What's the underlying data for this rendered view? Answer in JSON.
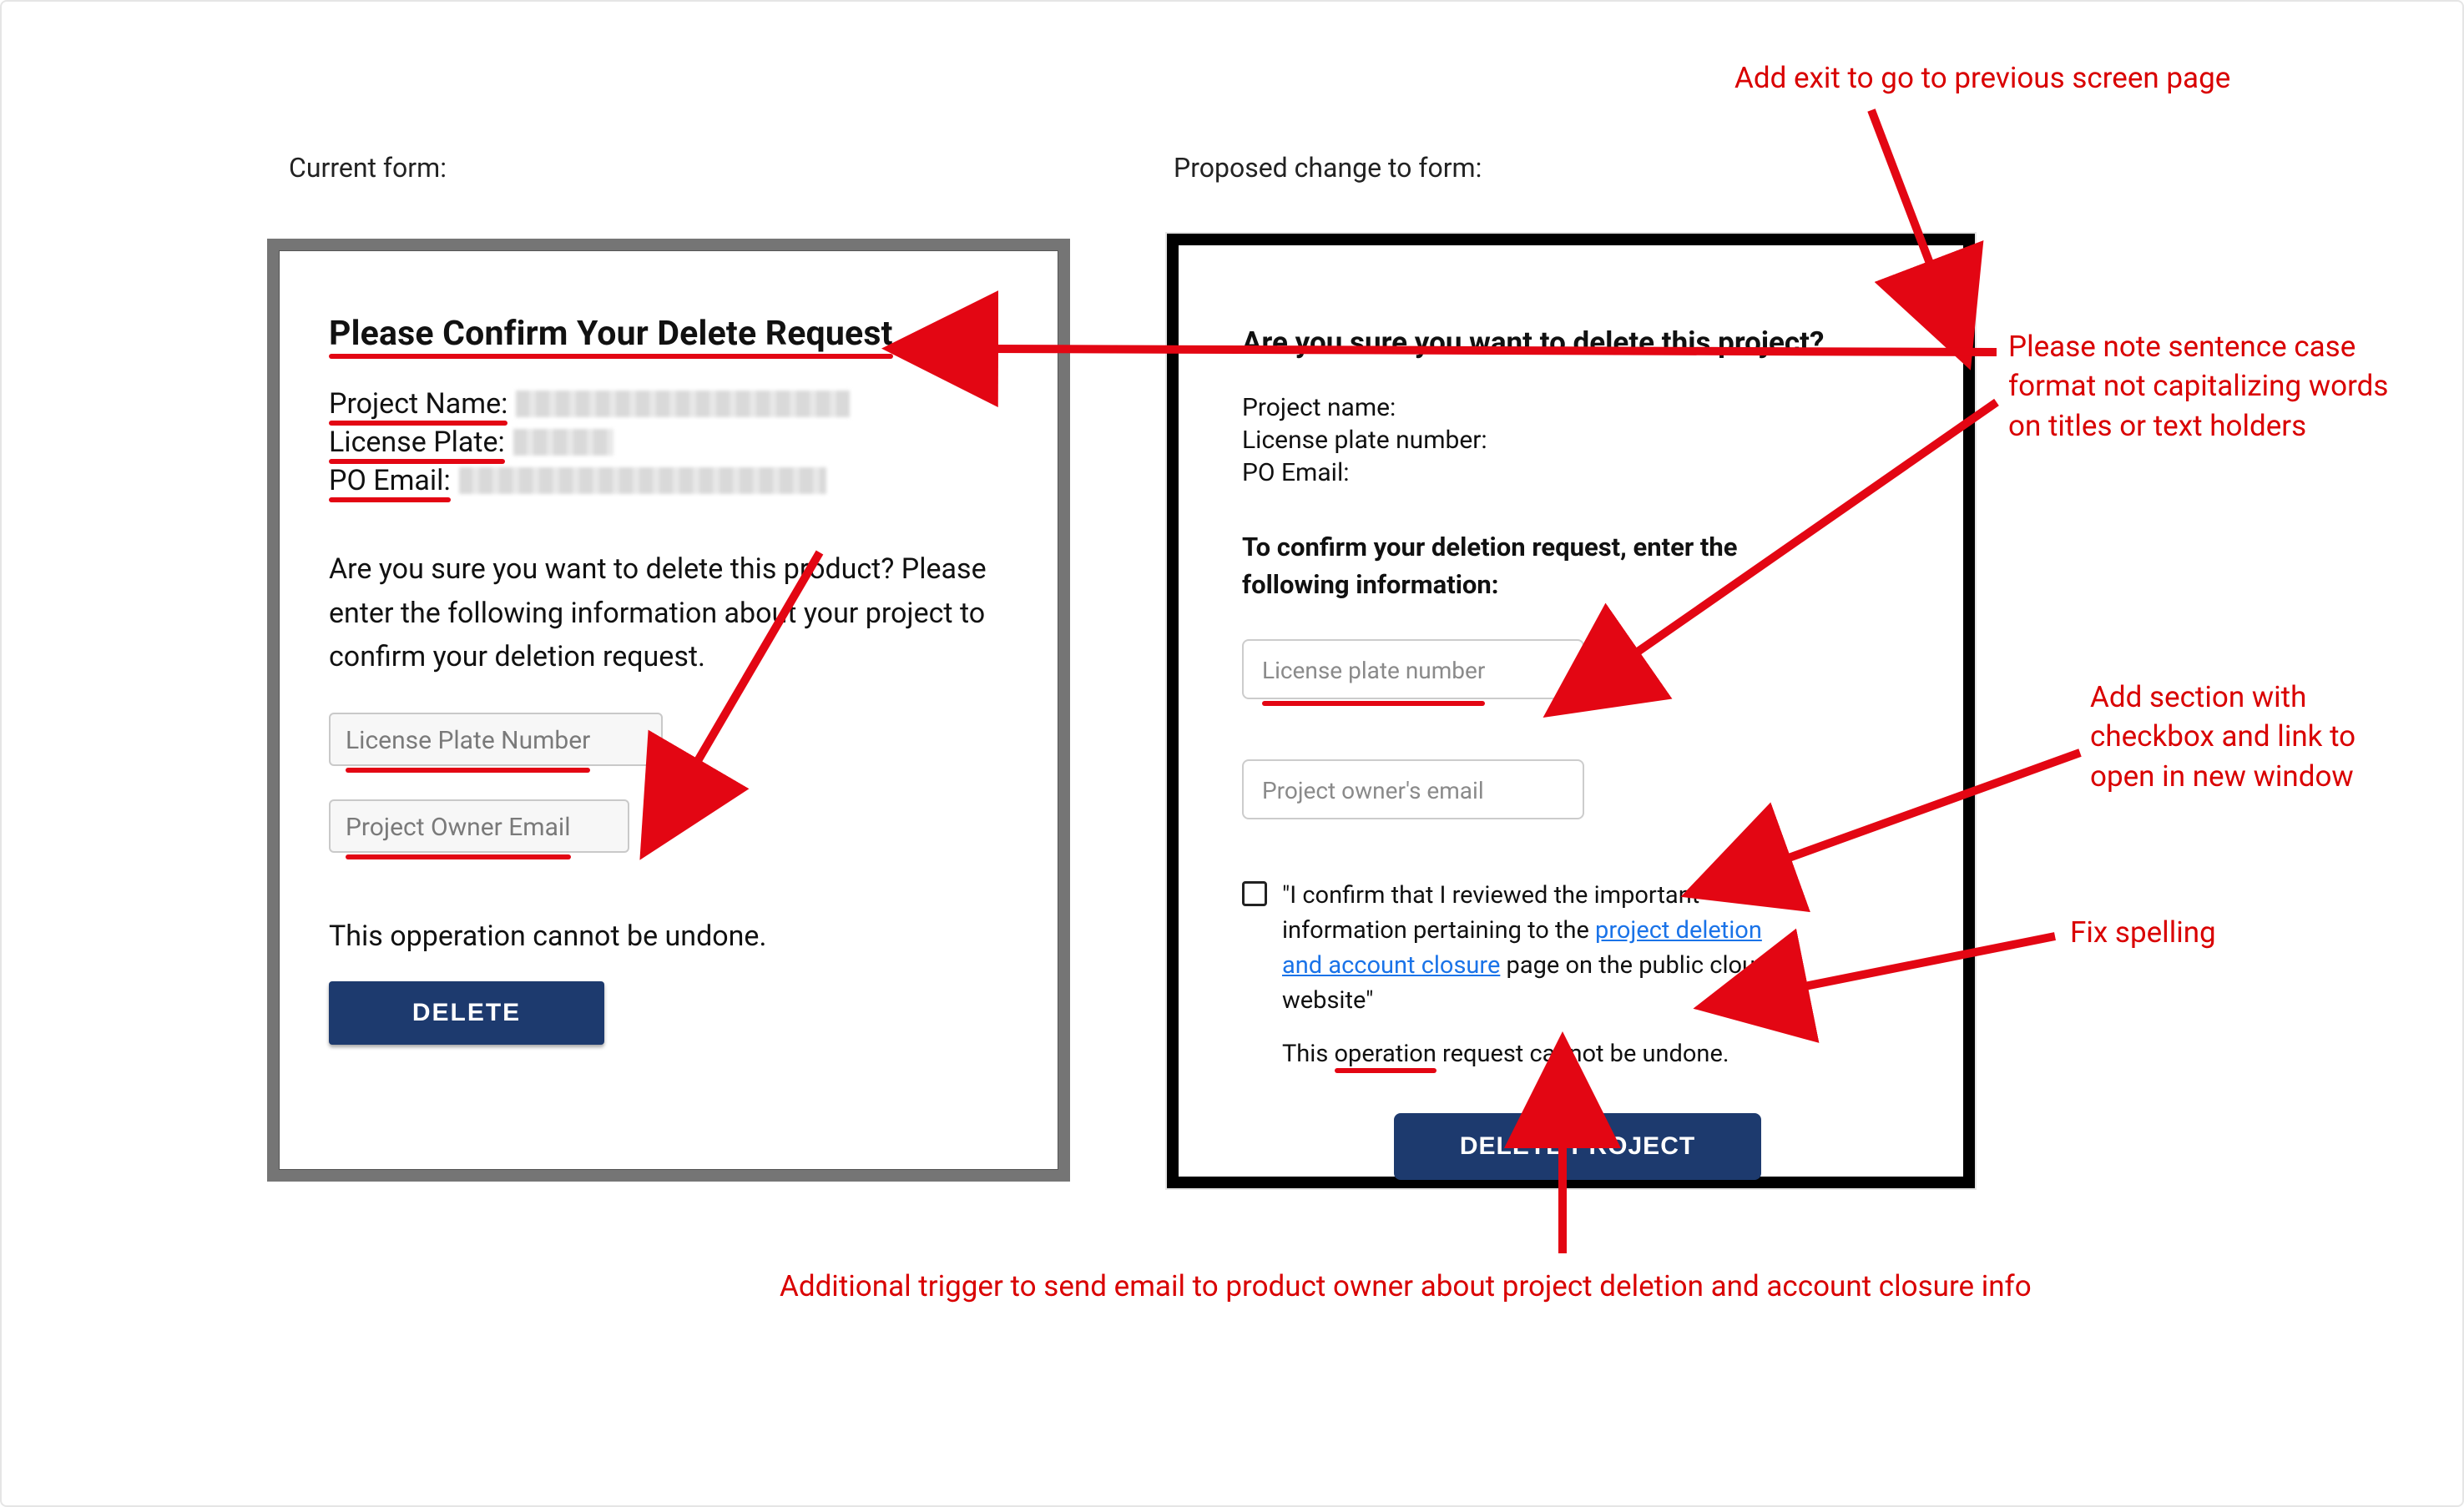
{
  "labels": {
    "current": "Current form:",
    "proposed": "Proposed change to form:"
  },
  "current_form": {
    "title": "Please Confirm Your Delete Request",
    "fields": {
      "project_name_label": "Project Name:",
      "license_plate_label": "License Plate:",
      "po_email_label": "PO Email:"
    },
    "body": "Are you sure you want to delete this product? Please enter the following information about your project to confirm your deletion request.",
    "input1_placeholder": "License Plate Number",
    "input2_placeholder": "Project Owner Email",
    "warning": "This opperation cannot be undone.",
    "delete_label": "DELETE"
  },
  "proposed_form": {
    "title": "Are you sure you want to delete this project?",
    "fields": {
      "project_name_label": "Project name:",
      "license_plate_label": "License plate number:",
      "po_email_label": "PO Email:"
    },
    "confirm_heading": "To confirm your deletion request, enter the following information:",
    "input1_placeholder": "License plate number",
    "input2_placeholder": "Project owner's email",
    "checkbox_text_pre": "\"I confirm that I reviewed the important information pertaining to the ",
    "checkbox_link": "project deletion and account closure",
    "checkbox_text_post": " page on the public cloud website\"",
    "warning_pre": "This ",
    "warning_word": "operation",
    "warning_post": " request cannot be undone.",
    "delete_label": "DELETE PROJECT"
  },
  "annotations": {
    "exit": "Add exit to go to previous screen page",
    "sentence_case": "Please note sentence case format not capitalizing words on titles or text holders",
    "checkbox_section": "Add section with checkbox and link to open in new window",
    "fix_spelling": "Fix spelling",
    "trigger_email": "Additional trigger to send email to product owner about project deletion and account closure info"
  },
  "colors": {
    "annotation_red": "#d90000",
    "button_navy": "#1d3a6e",
    "link_blue": "#1a73e8"
  }
}
